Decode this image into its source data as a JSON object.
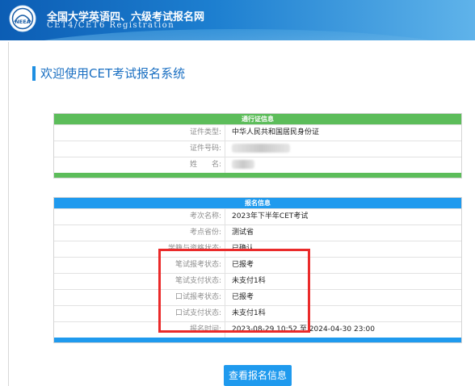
{
  "header": {
    "title_cn": "全国大学英语四、六级考试报名网",
    "title_en": "CET4/CET6  Registration",
    "logo_text": "NEEA"
  },
  "heading": "欢迎使用CET考试报名系统",
  "pass_info": {
    "title": "通行证信息",
    "rows": [
      {
        "label": "证件类型:",
        "value": "中华人民共和国居民身份证"
      },
      {
        "label": "证件号码:",
        "value": ""
      },
      {
        "label": "姓　　名:",
        "value": ""
      }
    ]
  },
  "reg_info": {
    "title": "报名信息",
    "rows": [
      {
        "label": "考次名称:",
        "value": "2023年下半年CET考试"
      },
      {
        "label": "考点省份:",
        "value": "测试省"
      },
      {
        "label": "学籍与资格状态:",
        "value": "已确认"
      },
      {
        "label": "笔试报考状态:",
        "value": "已报考"
      },
      {
        "label": "笔试支付状态:",
        "value": "未支付1科"
      },
      {
        "label": "口试报考状态:",
        "value": "已报考"
      },
      {
        "label": "口试支付状态:",
        "value": "未支付1科"
      },
      {
        "label": "报名时间:",
        "value": "2023-08-29 10:52 至 2024-04-30 23:00"
      }
    ]
  },
  "buttons": {
    "view": "查看报名信息"
  },
  "colors": {
    "green": "#5cbd5a",
    "blue": "#1f9aee",
    "highlight": "#ea2a2a"
  }
}
